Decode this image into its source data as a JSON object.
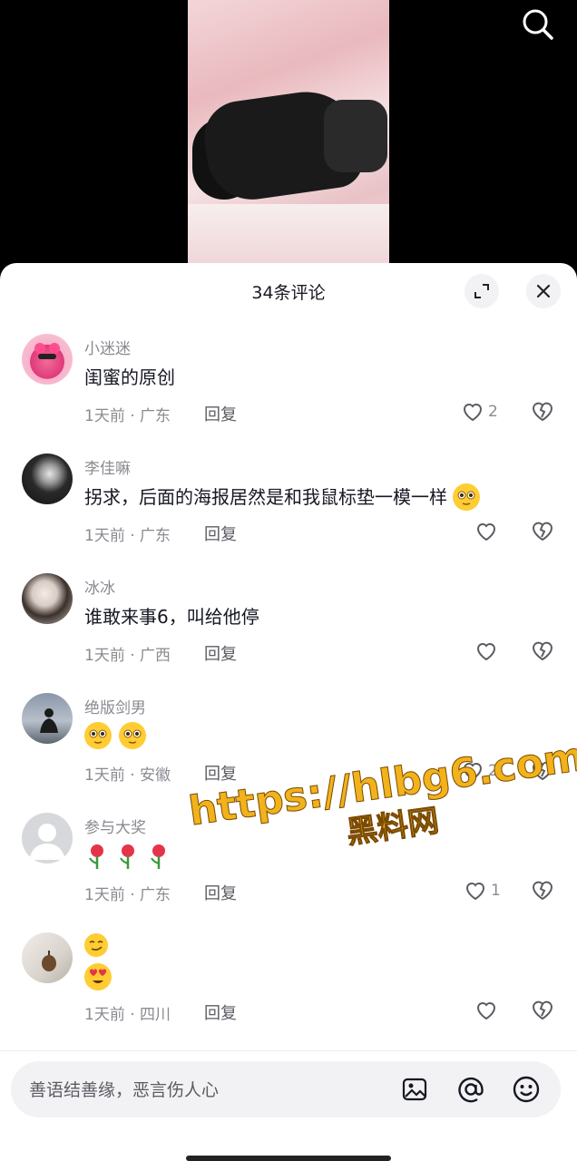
{
  "header": {
    "title": "34条评论"
  },
  "comments": [
    {
      "username": "小迷迷",
      "text": "闺蜜的原创",
      "meta": "1天前 · 广东",
      "reply": "回复",
      "likes": "2",
      "avatar": "pink-avatar"
    },
    {
      "username": "李佳嘛",
      "text": "拐求，后面的海报居然是和我鼠标垫一模一样",
      "meta": "1天前 · 广东",
      "reply": "回复",
      "likes": "",
      "avatar": "dark-avatar"
    },
    {
      "username": "冰冰",
      "text": "谁敢来事6，叫给他停",
      "meta": "1天前 · 广西",
      "reply": "回复",
      "likes": "",
      "avatar": "girl-avatar"
    },
    {
      "username": "绝版剑男",
      "text": "",
      "meta": "1天前 · 安徽",
      "reply": "回复",
      "likes": "2",
      "avatar": "silhouette-avatar"
    },
    {
      "username": "参与大奖",
      "text": "",
      "meta": "1天前 · 广东",
      "reply": "回复",
      "likes": "1",
      "avatar": "default-avatar"
    },
    {
      "username": "",
      "text": "",
      "meta": "1天前 · 四川",
      "reply": "回复",
      "likes": "",
      "avatar": "pinecone-avatar"
    }
  ],
  "input": {
    "placeholder": "善语结善缘，恶言伤人心"
  },
  "watermark": {
    "line1": "https://hlbg6.com",
    "line2": "黑料网"
  },
  "colors": {
    "accent": "#161823",
    "muted": "#8a8b91",
    "watermark": "#f2b21b"
  }
}
